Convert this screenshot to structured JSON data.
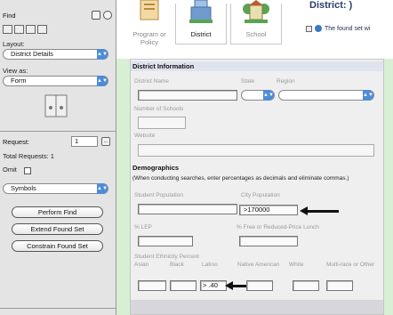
{
  "sidebar": {
    "mode": "Find",
    "layout_label": "Layout:",
    "layout_value": "District Details",
    "view_label": "View as:",
    "view_value": "Form",
    "request_label": "Request:",
    "request_value": "1",
    "request_btn": "...",
    "total_requests": "Total Requests: 1",
    "omit_label": "Omit",
    "symbols_value": "Symbols",
    "perform_find": "Perform Find",
    "extend_found_set": "Extend Found Set",
    "constrain_found_set": "Constrain Found Set"
  },
  "header": {
    "nav": [
      {
        "label": "Program or\nPolicy",
        "icon": "program-icon"
      },
      {
        "label": "District",
        "icon": "district-building-icon"
      },
      {
        "label": "School",
        "icon": "school-icon"
      }
    ],
    "title": "District: )",
    "status": "The found set wi"
  },
  "form": {
    "heading": "District Information",
    "labels": {
      "district_name": "District Name",
      "state": "State",
      "region": "Region",
      "num_schools": "Number of Schools",
      "website": "Website",
      "student_population": "Student Population",
      "city_population": "City Population",
      "pct_lep": "% LEP",
      "pct_free_lunch": "% Free or Reduced-Price Lunch",
      "ethnicity": "Student Ethnicity Percent",
      "asian": "Asian",
      "black": "Black",
      "latino": "Latino",
      "native_american": "Native American",
      "white": "White",
      "multirace": "Multi-race or Other"
    },
    "demographics_heading": "Demographics",
    "demographics_note": "(When conducting searches, enter percentages as decimals and eliminate commas.)",
    "city_population_value": ">170000",
    "latino_value": "> .40"
  },
  "colors": {
    "background": "#d8efd6",
    "accent": "#4f8cd8",
    "form_bg": "#efefef"
  }
}
